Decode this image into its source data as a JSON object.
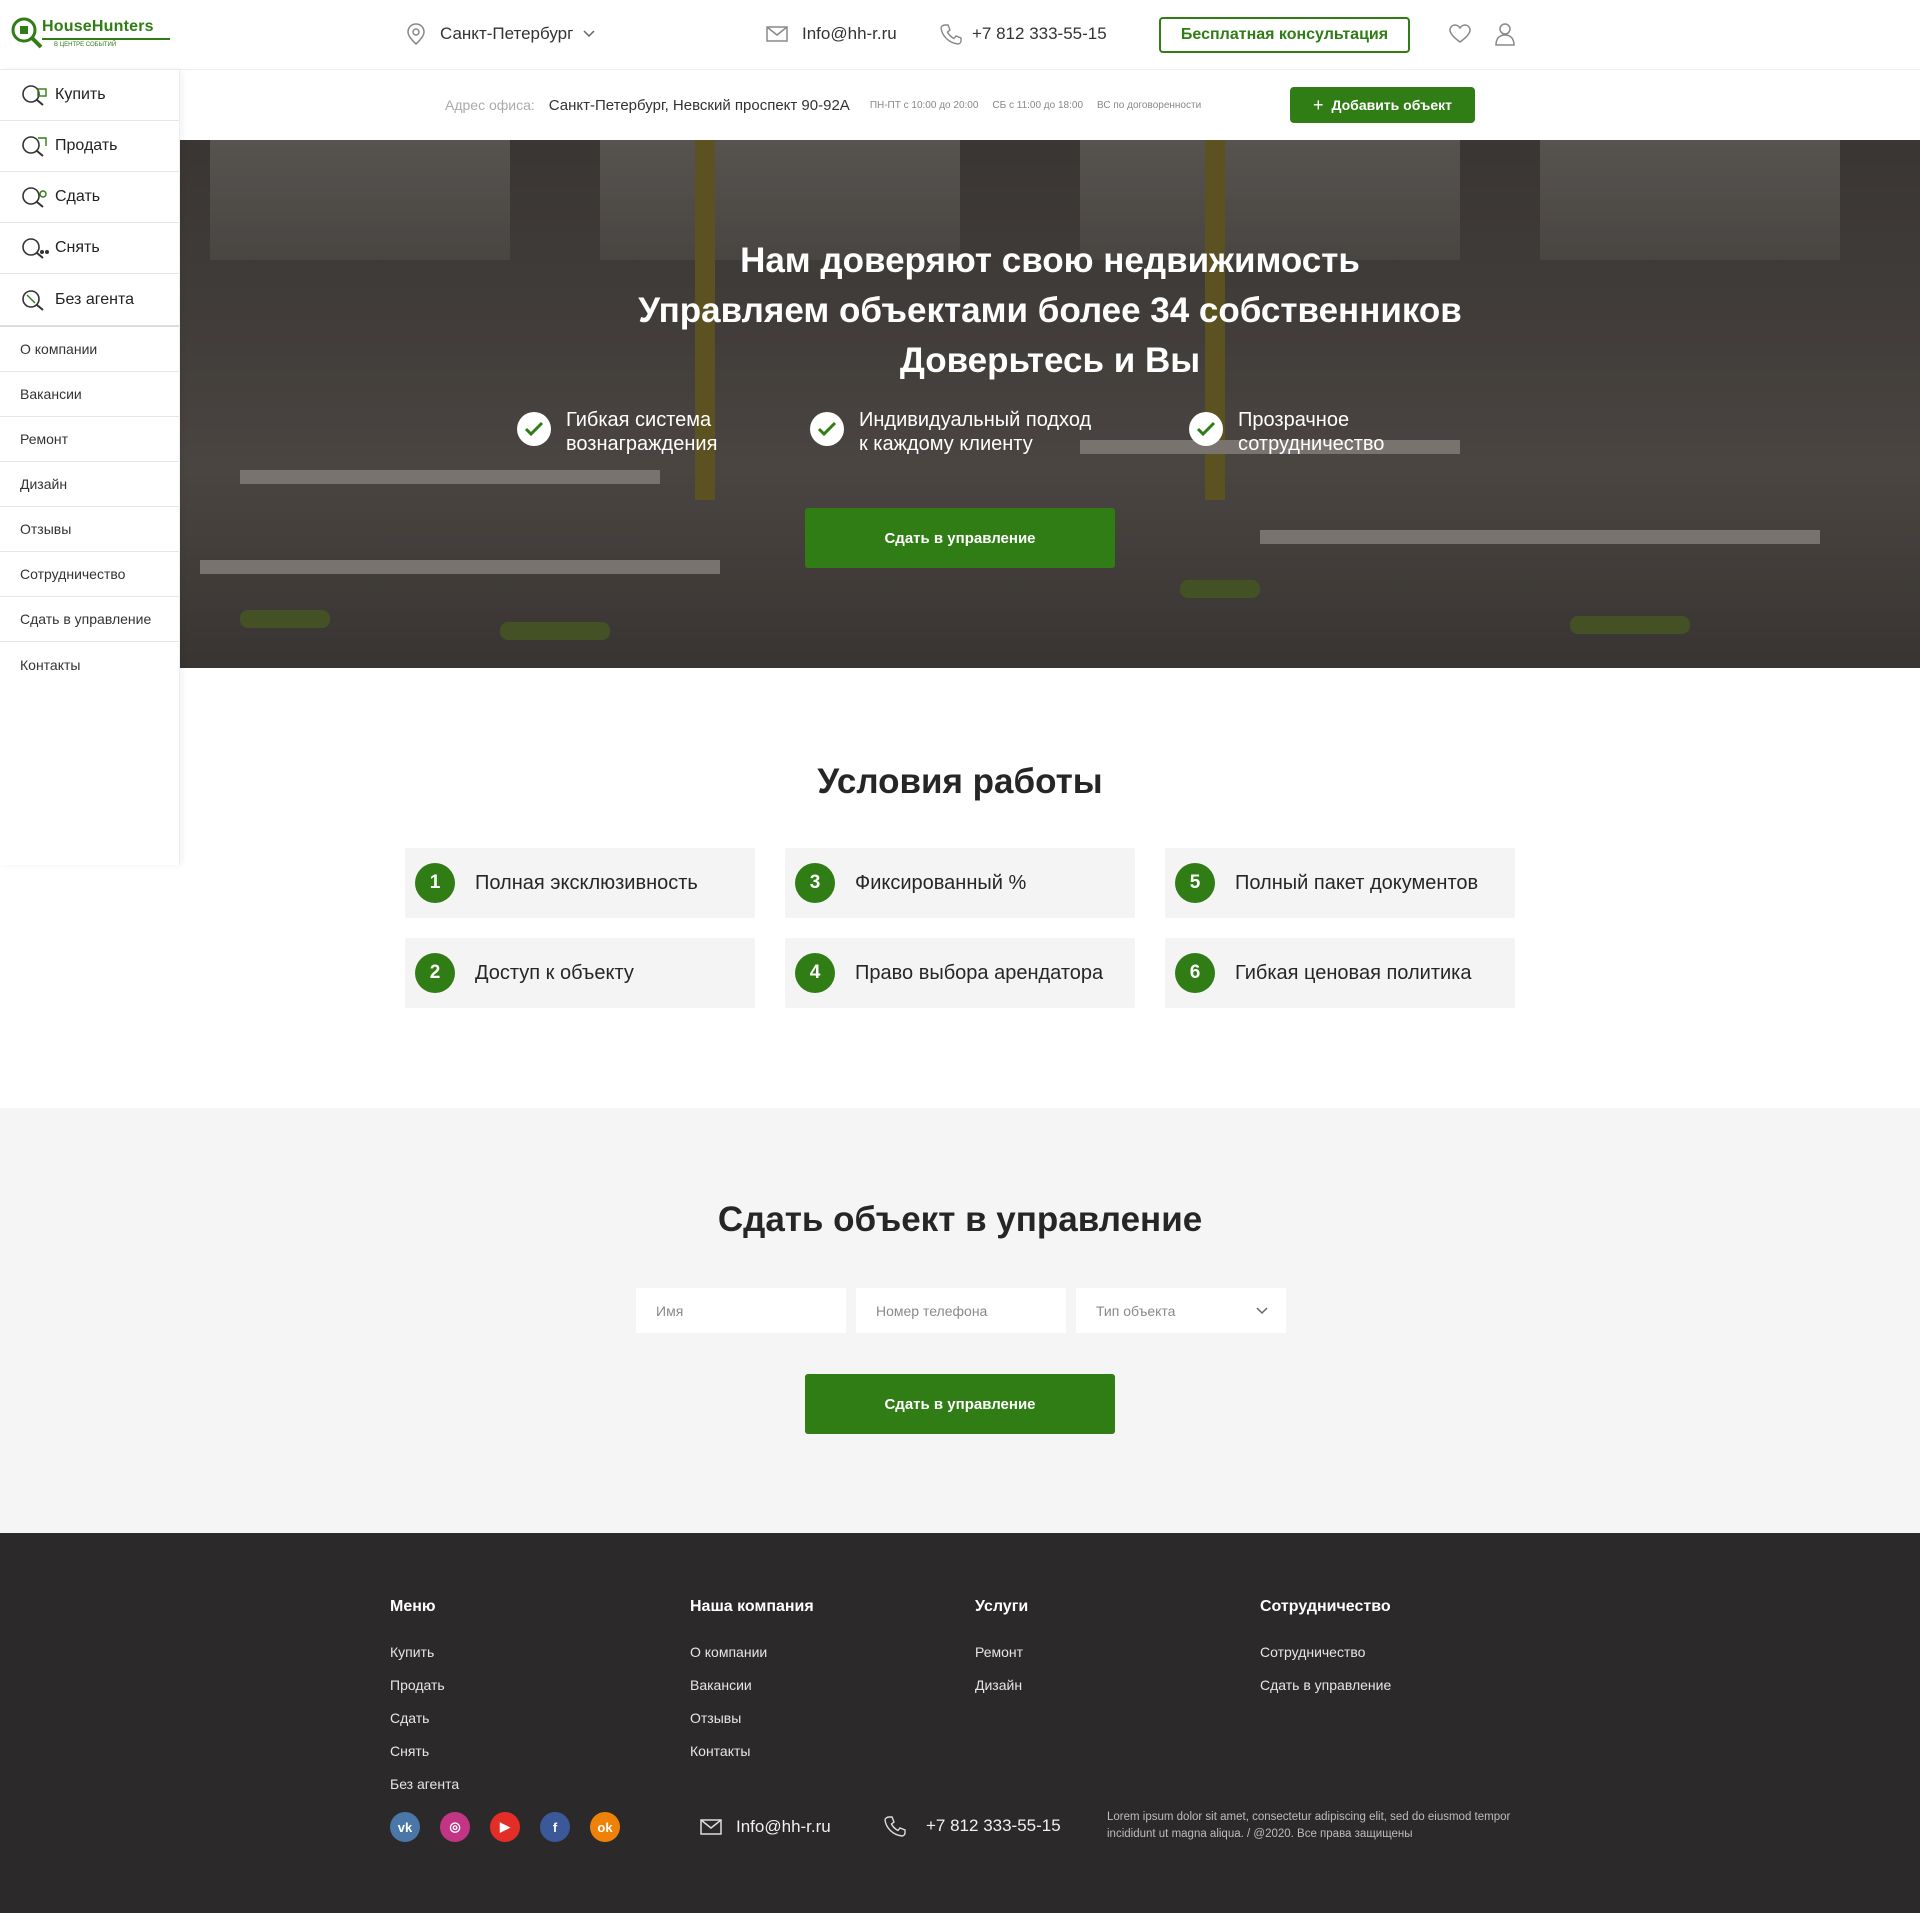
{
  "header": {
    "logo_name": "HouseHunters",
    "logo_tagline": "В ЦЕНТРЕ СОБЫТИЙ",
    "city": "Санкт-Петербург",
    "email": "Info@hh-r.ru",
    "phone": "+7 812 333-55-15",
    "consult_button": "Бесплатная консультация"
  },
  "sidebar": {
    "main": [
      {
        "label": "Купить",
        "icon": "buy-icon"
      },
      {
        "label": "Продать",
        "icon": "sell-icon"
      },
      {
        "label": "Сдать",
        "icon": "rent-out-icon"
      },
      {
        "label": "Снять",
        "icon": "rent-icon"
      },
      {
        "label": "Без агента",
        "icon": "no-agent-icon"
      }
    ],
    "sub": [
      "О компании",
      "Вакансии",
      "Ремонт",
      "Дизайн",
      "Отзывы",
      "Сотрудничество",
      "Сдать в управление",
      "Контакты"
    ]
  },
  "infobar": {
    "address_label": "Адрес офиса:",
    "address": "Санкт-Петербург, Невский проспект 90-92А",
    "hours": [
      "ПН-ПТ с 10:00 до 20:00",
      "СБ с 11:00 до 18:00",
      "ВС по договоренности"
    ],
    "add_button": "Добавить объект"
  },
  "hero": {
    "title_lines": [
      "Нам доверяют свою недвижимость",
      "Управляем объектами более 34 собственников",
      "Доверьтесь и Вы"
    ],
    "features": [
      {
        "line1": "Гибкая система",
        "line2": "вознаграждения"
      },
      {
        "line1": "Индивидуальный подход",
        "line2": "к каждому клиенту"
      },
      {
        "line1": "Прозрачное",
        "line2": "сотрудничество"
      }
    ],
    "button": "Сдать в управление"
  },
  "conditions": {
    "title": "Условия работы",
    "items": [
      {
        "num": "1",
        "text": "Полная эксклюзивность"
      },
      {
        "num": "2",
        "text": "Доступ к объекту"
      },
      {
        "num": "3",
        "text": "Фиксированный %"
      },
      {
        "num": "4",
        "text": "Право выбора арендатора"
      },
      {
        "num": "5",
        "text": "Полный пакет документов"
      },
      {
        "num": "6",
        "text": "Гибкая ценовая политика"
      }
    ]
  },
  "form": {
    "title": "Сдать объект в управление",
    "name_placeholder": "Имя",
    "phone_placeholder": "Номер телефона",
    "type_placeholder": "Тип объекта",
    "button": "Сдать в управление"
  },
  "footer": {
    "columns": [
      {
        "head": "Меню",
        "links": [
          "Купить",
          "Продать",
          "Сдать",
          "Снять",
          "Без агента"
        ]
      },
      {
        "head": "Наша компания",
        "links": [
          "О компании",
          "Вакансии",
          "Отзывы",
          "Контакты"
        ]
      },
      {
        "head": "Услуги",
        "links": [
          "Ремонт",
          "Дизайн"
        ]
      },
      {
        "head": "Сотрудничество",
        "links": [
          "Сотрудничество",
          "Сдать в управление"
        ]
      }
    ],
    "socials": [
      {
        "name": "vk-icon",
        "glyph": "vk",
        "color": "#4a76a8"
      },
      {
        "name": "instagram-icon",
        "glyph": "◎",
        "color": "#c13584"
      },
      {
        "name": "youtube-icon",
        "glyph": "▶",
        "color": "#e52d27"
      },
      {
        "name": "facebook-icon",
        "glyph": "f",
        "color": "#3b5998"
      },
      {
        "name": "odnoklassniki-icon",
        "glyph": "ok",
        "color": "#ee8208"
      }
    ],
    "email": "Info@hh-r.ru",
    "phone": "+7 812 333-55-15",
    "copyright": "Lorem ipsum dolor sit amet, consectetur adipiscing elit, sed do eiusmod tempor incididunt ut  magna aliqua.  / @2020. Все права защищены"
  },
  "colors": {
    "brand_green": "#2f7d14",
    "footer_bg": "#2b292a",
    "card_bg": "#f4f4f4"
  }
}
